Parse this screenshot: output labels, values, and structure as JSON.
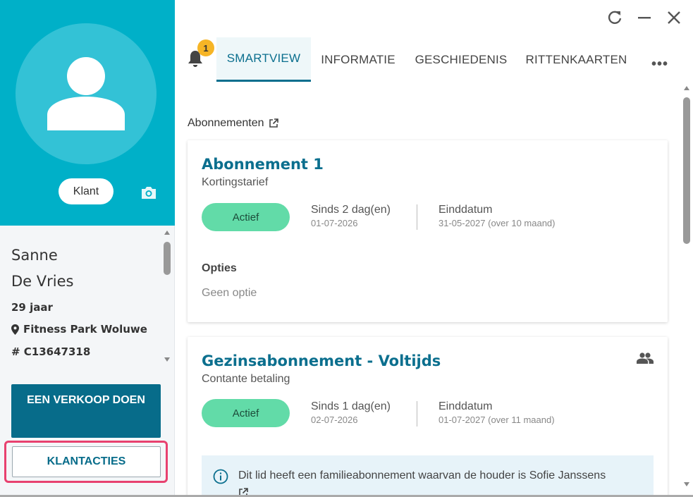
{
  "window": {
    "controls": [
      "refresh-icon",
      "minimize-icon",
      "close-icon"
    ]
  },
  "profile": {
    "badge": "Klant",
    "first_name": "Sanne",
    "last_name": "De Vries",
    "age": "29 jaar",
    "location": "Fitness Park Woluwe",
    "client_number": "# C13647318"
  },
  "actions": {
    "sale_label": "EEN VERKOOP DOEN",
    "client_actions_label": "KLANTACTIES"
  },
  "notifications": {
    "count": "1"
  },
  "tabs": [
    {
      "label": "SMARTVIEW",
      "active": true
    },
    {
      "label": "INFORMATIE",
      "active": false
    },
    {
      "label": "GESCHIEDENIS",
      "active": false
    },
    {
      "label": "RITTENKAARTEN",
      "active": false
    }
  ],
  "more_label": "•••",
  "section": {
    "title": "Abonnementen"
  },
  "subscriptions": [
    {
      "title": "Abonnement 1",
      "subtitle": "Kortingstarief",
      "status": "Actief",
      "since_label": "Sinds 2 dag(en)",
      "since_date": "01-07-2026",
      "end_label": "Einddatum",
      "end_date": "31-05-2027 (over 10 maand)",
      "options_label": "Opties",
      "options_value": "Geen optie"
    },
    {
      "title": "Gezinsabonnement - Voltijds",
      "subtitle": "Contante betaling",
      "status": "Actief",
      "since_label": "Sinds 1 dag(en)",
      "since_date": "02-07-2026",
      "end_label": "Einddatum",
      "end_date": "01-07-2027 (over 11 maand)",
      "info_text": "Dit lid heeft een familieabonnement waarvan de houder is Sofie Janssens"
    }
  ],
  "colors": {
    "header_bg": "#00b0c8",
    "primary": "#076c8a",
    "status_active": "#62dba8",
    "highlight": "#e8416f",
    "badge": "#f6b526"
  }
}
